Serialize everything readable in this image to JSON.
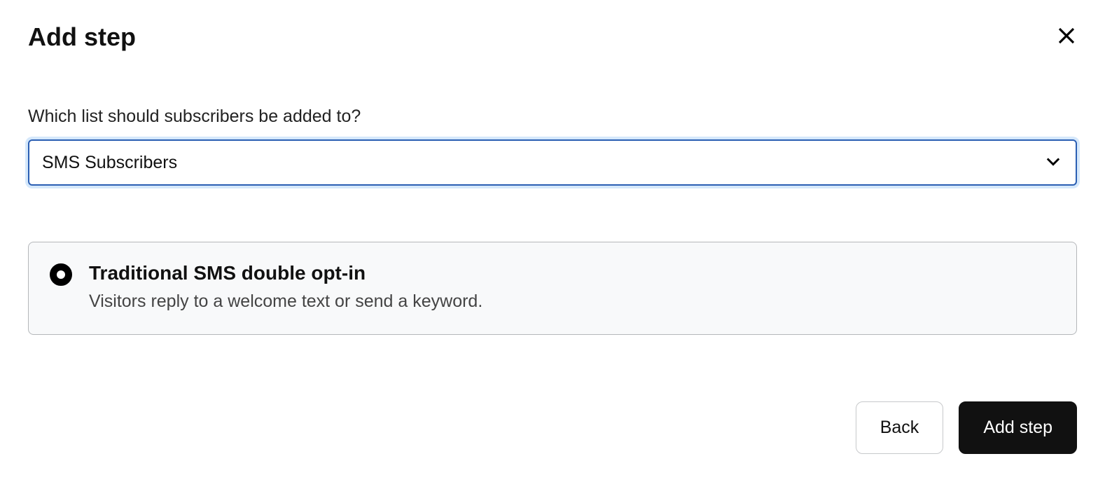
{
  "header": {
    "title": "Add step"
  },
  "form": {
    "list_label": "Which list should subscribers be added to?",
    "list_selected": "SMS Subscribers"
  },
  "option": {
    "title": "Traditional SMS double opt-in",
    "description": "Visitors reply to a welcome text or send a keyword."
  },
  "footer": {
    "back_label": "Back",
    "add_label": "Add step"
  }
}
